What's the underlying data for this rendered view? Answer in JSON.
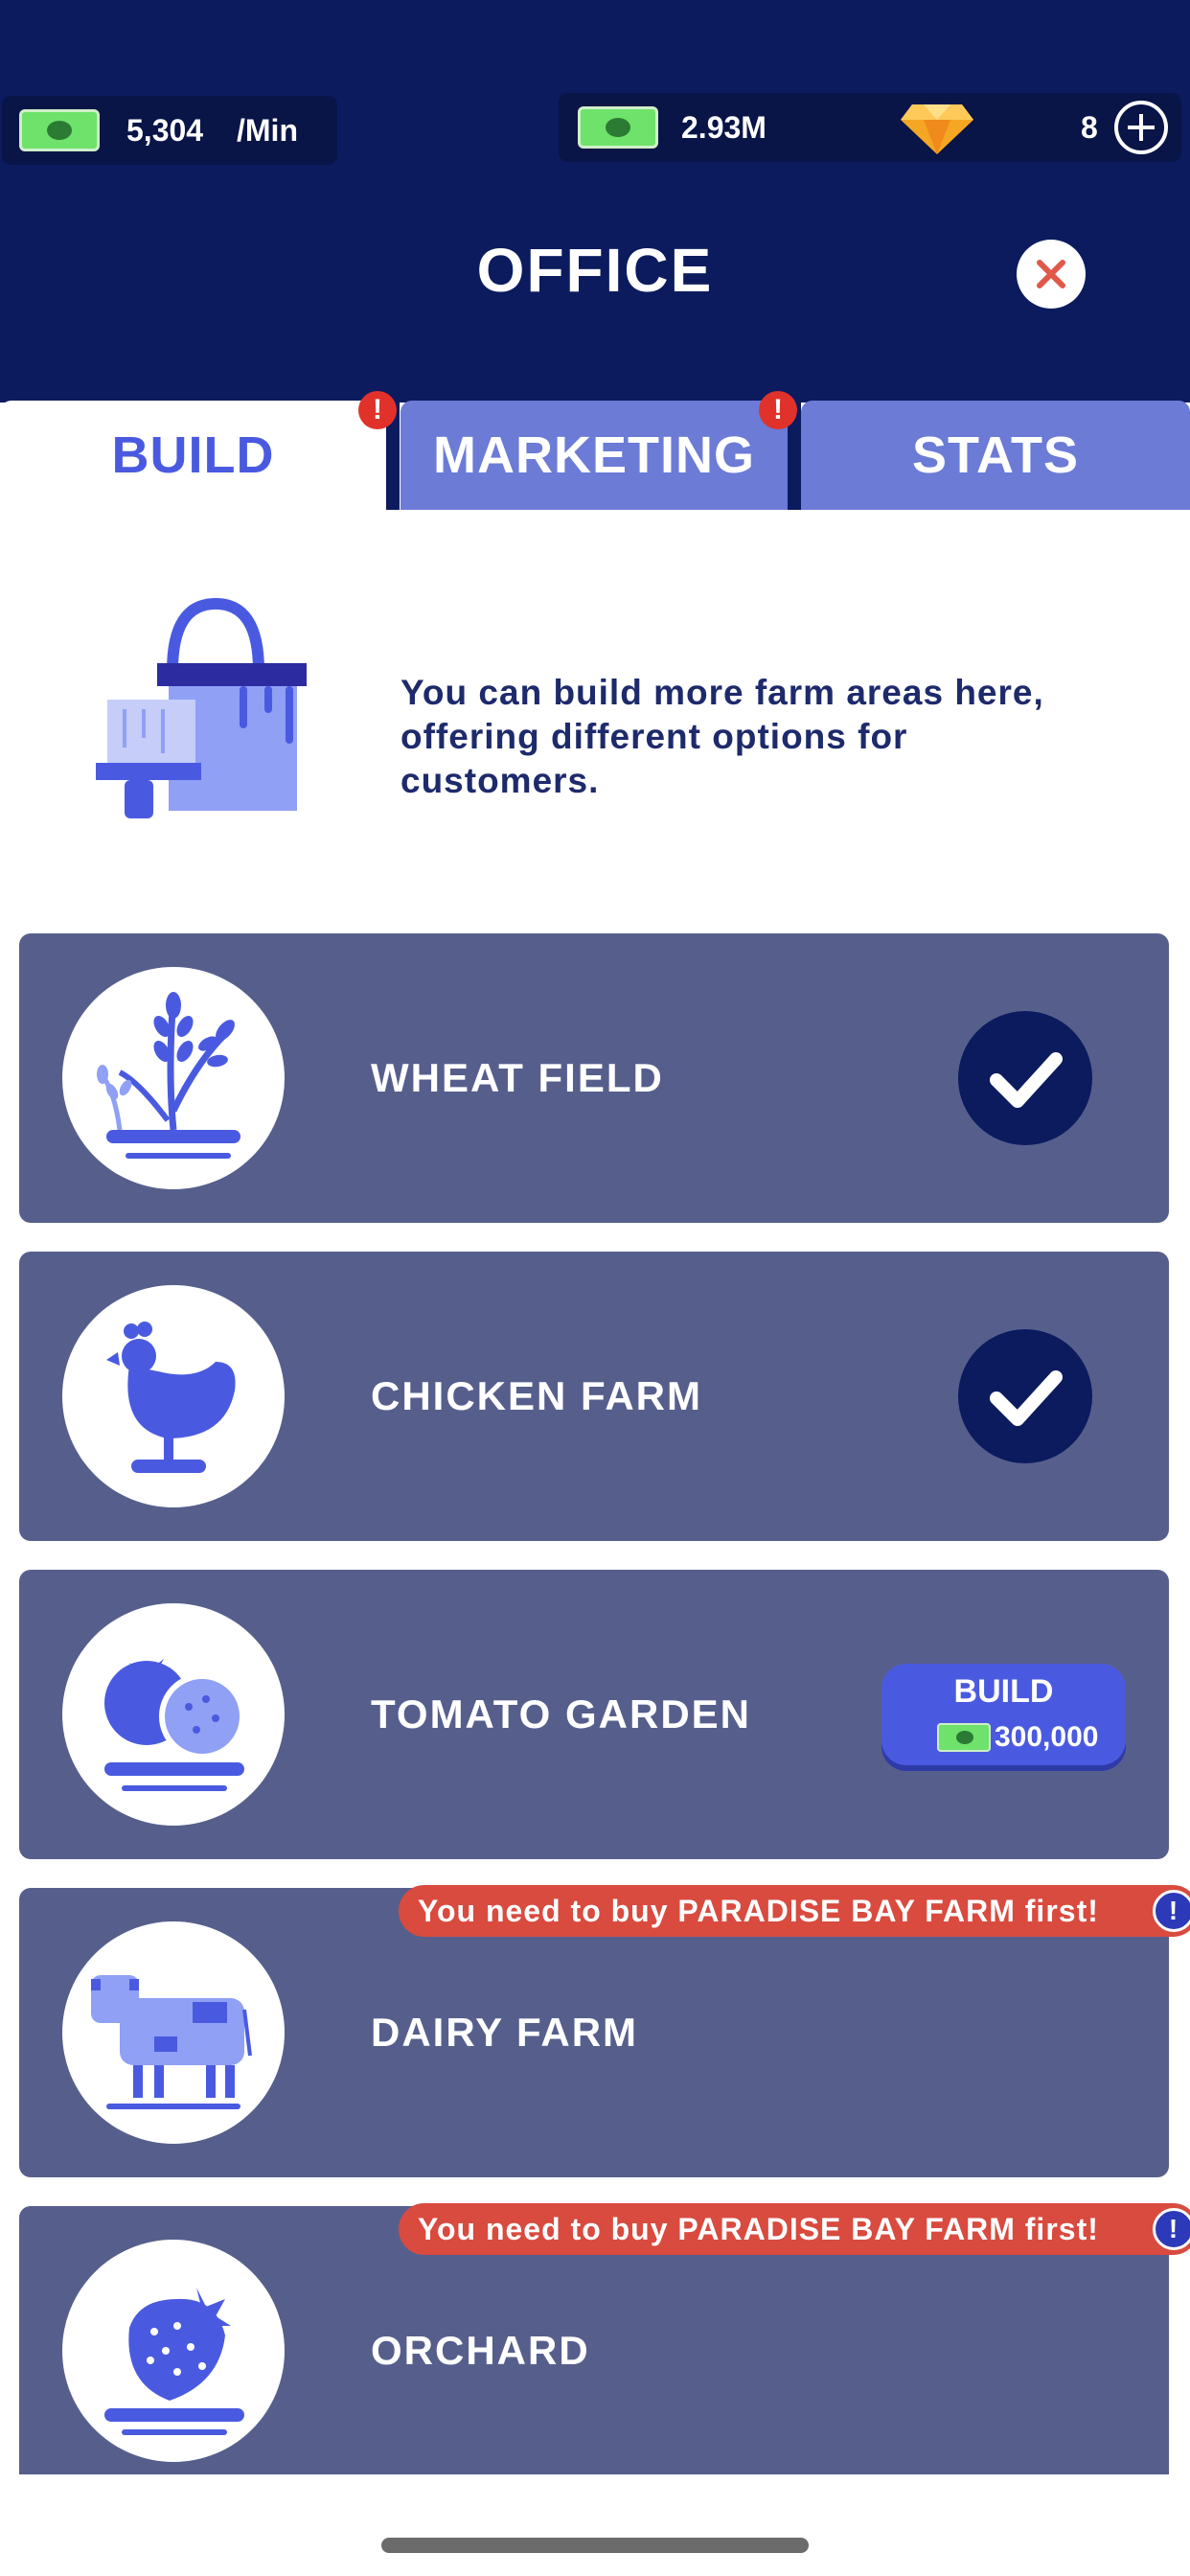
{
  "header": {
    "income_value": "5,304",
    "income_unit": "/Min",
    "cash_total": "2.93M",
    "gem_count": "8",
    "title": "OFFICE",
    "close_icon": "close-icon"
  },
  "tabs": [
    {
      "label": "BUILD",
      "active": true,
      "alert": true
    },
    {
      "label": "MARKETING",
      "active": false,
      "alert": true
    },
    {
      "label": "STATS",
      "active": false,
      "alert": false
    }
  ],
  "intro": {
    "text": "You can build more farm areas here, offering different options for customers.",
    "icon": "paint-bucket-icon"
  },
  "items": [
    {
      "name": "WHEAT FIELD",
      "icon": "wheat-icon",
      "status": "built"
    },
    {
      "name": "CHICKEN FARM",
      "icon": "chicken-icon",
      "status": "built"
    },
    {
      "name": "TOMATO GARDEN",
      "icon": "tomato-icon",
      "status": "buildable",
      "build_label": "BUILD",
      "price": "300,000"
    },
    {
      "name": "DAIRY FARM",
      "icon": "cow-icon",
      "status": "locked",
      "warning": "You need to buy PARADISE BAY FARM first!"
    },
    {
      "name": "ORCHARD",
      "icon": "strawberry-icon",
      "status": "locked",
      "warning": "You need to buy PARADISE BAY FARM first!"
    }
  ],
  "alert_symbol": "!",
  "colors": {
    "header_bg": "#0b1b5e",
    "accent": "#4a5ae0",
    "row_bg": "#565f8c",
    "warning": "#d94a3f",
    "cash_green": "#6ee26b",
    "gem_orange": "#f5a623"
  }
}
